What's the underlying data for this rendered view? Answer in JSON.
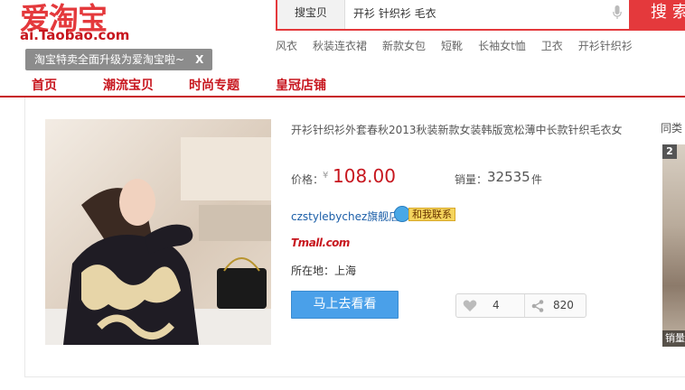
{
  "logo": {
    "cn": "爱淘宝",
    "en": "ai.Taobao.com"
  },
  "tip": {
    "text": "淘宝特卖全面升级为爱淘宝啦~",
    "close": "X"
  },
  "search": {
    "type": "搜宝贝",
    "value": "开衫 针织衫 毛衣",
    "button": "搜 索"
  },
  "hotwords": [
    "风衣",
    "秋装连衣裙",
    "新款女包",
    "短靴",
    "长袖女t恤",
    "卫衣",
    "开衫针织衫"
  ],
  "nav": [
    "首页",
    "潮流宝贝",
    "时尚专题",
    "皇冠店铺"
  ],
  "product": {
    "title": "开衫针织衫外套春秋2013秋装新款女装韩版宽松薄中长款针织毛衣女",
    "price_label": "价格：",
    "price_symbol": "¥",
    "price": "108.00",
    "sales_label": "销量：",
    "sales": "32535",
    "sales_unit": "件",
    "shop": "czstylebychez旗舰店",
    "contact": "和我联系",
    "tmall": "Tmall.com",
    "location": "所在地：上海",
    "buy_button": "马上去看看",
    "likes": "4",
    "shares": "820"
  },
  "similar": {
    "label": "同类",
    "index": "2",
    "caption": "销量"
  },
  "colors": {
    "brand_red": "#e4393c",
    "nav_red": "#c7161e",
    "buy_blue": "#4aa0e9",
    "link_blue": "#1b5ea8"
  }
}
